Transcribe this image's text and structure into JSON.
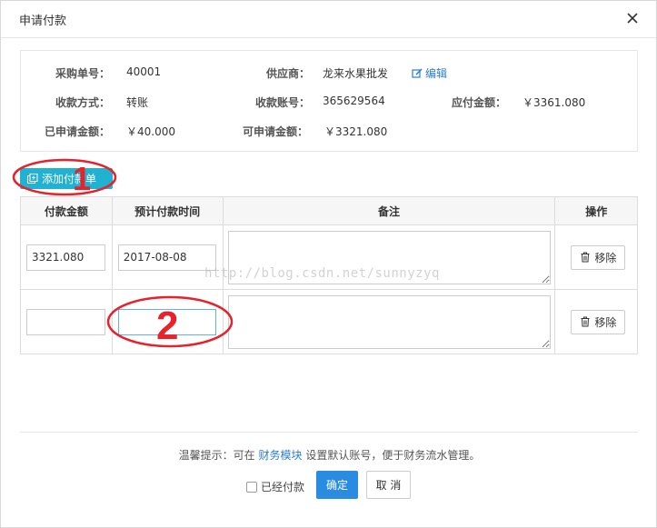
{
  "modal": {
    "title": "申请付款"
  },
  "info": {
    "po_label": "采购单号：",
    "po_value": "40001",
    "supplier_label": "供应商：",
    "supplier_value": "龙来水果批发",
    "edit_label": "编辑",
    "pay_method_label": "收款方式：",
    "pay_method_value": "转账",
    "account_label": "收款账号：",
    "account_value": "365629564",
    "payable_label": "应付金额：",
    "payable_value": "￥3361.080",
    "applied_label": "已申请金额：",
    "applied_value": "￥40.000",
    "available_label": "可申请金额：",
    "available_value": "￥3321.080"
  },
  "add_button": {
    "label": "添加付款单"
  },
  "table": {
    "headers": {
      "amount": "付款金额",
      "date": "预计付款时间",
      "note": "备注",
      "op": "操作"
    },
    "rows": [
      {
        "amount": "3321.080",
        "date": "2017-08-08",
        "note": "",
        "remove": "移除"
      },
      {
        "amount": "",
        "date": "",
        "note": "",
        "remove": "移除"
      }
    ]
  },
  "annotations": {
    "one": "1",
    "two": "2",
    "color": "#e8212b"
  },
  "watermark": "http://blog.csdn.net/sunnyzyq",
  "footer": {
    "tip_prefix": "温馨提示：可在 ",
    "tip_link": "财务模块",
    "tip_suffix": " 设置默认账号，便于财务流水管理。",
    "paid_label": "已经付款",
    "confirm_label": "确定",
    "cancel_label": "取 消"
  },
  "colors": {
    "accent": "#21b1d1",
    "primary": "#2a8ce0",
    "link": "#2a7bd6"
  }
}
